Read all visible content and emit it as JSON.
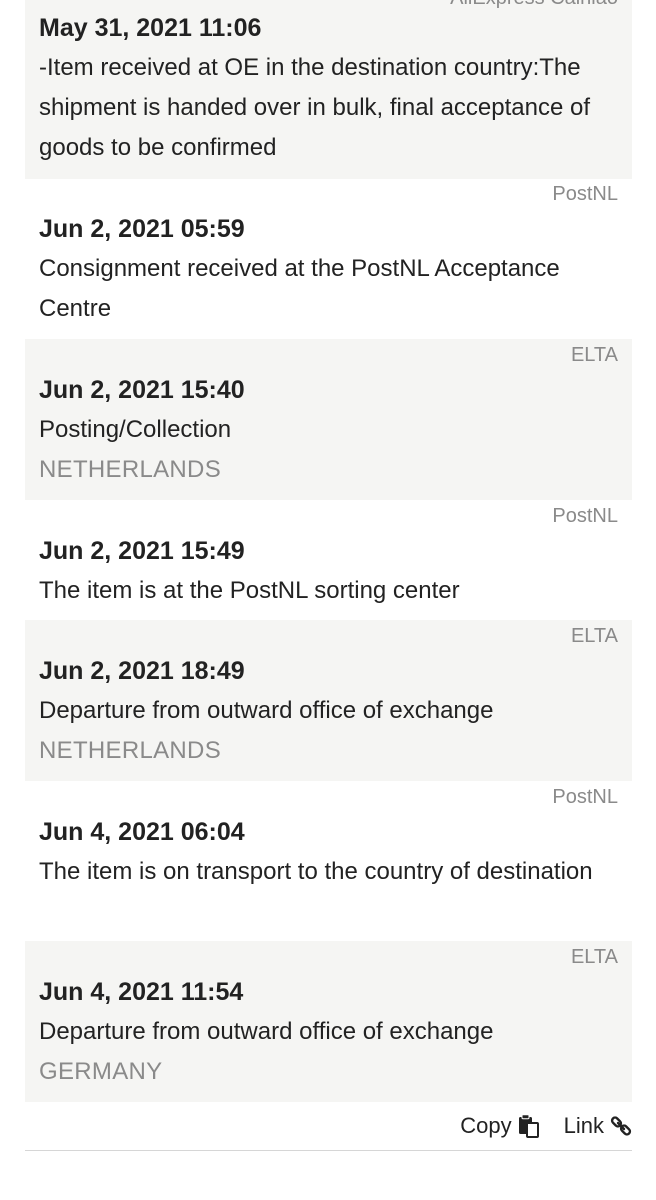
{
  "events": [
    {
      "carrier": "AliExpress Cainiao",
      "date": "May 31, 2021 11:06",
      "description": "-Item received at OE in the destination country:The shipment is handed over in bulk, final acceptance of goods to be confirmed",
      "location": ""
    },
    {
      "carrier": "PostNL",
      "date": "Jun 2, 2021 05:59",
      "description": "Consignment received at the PostNL Acceptance Centre",
      "location": ""
    },
    {
      "carrier": "ELTA",
      "date": "Jun 2, 2021 15:40",
      "description": "Posting/Collection",
      "location": "NETHERLANDS"
    },
    {
      "carrier": "PostNL",
      "date": "Jun 2, 2021 15:49",
      "description": "The item is at the PostNL sorting center",
      "location": ""
    },
    {
      "carrier": "ELTA",
      "date": "Jun 2, 2021 18:49",
      "description": "Departure from outward office of exchange",
      "location": "NETHERLANDS"
    },
    {
      "carrier": "PostNL",
      "date": "Jun 4, 2021 06:04",
      "description": "The item is on transport to the country of destination",
      "location": ""
    },
    {
      "carrier": "ELTA",
      "date": "Jun 4, 2021 11:54",
      "description": "Departure from outward office of exchange",
      "location": "GERMANY"
    }
  ],
  "footer": {
    "copy_label": "Copy",
    "copy_icon": "clipboard-icon",
    "link_label": "Link",
    "link_icon": "chain-link-icon"
  }
}
